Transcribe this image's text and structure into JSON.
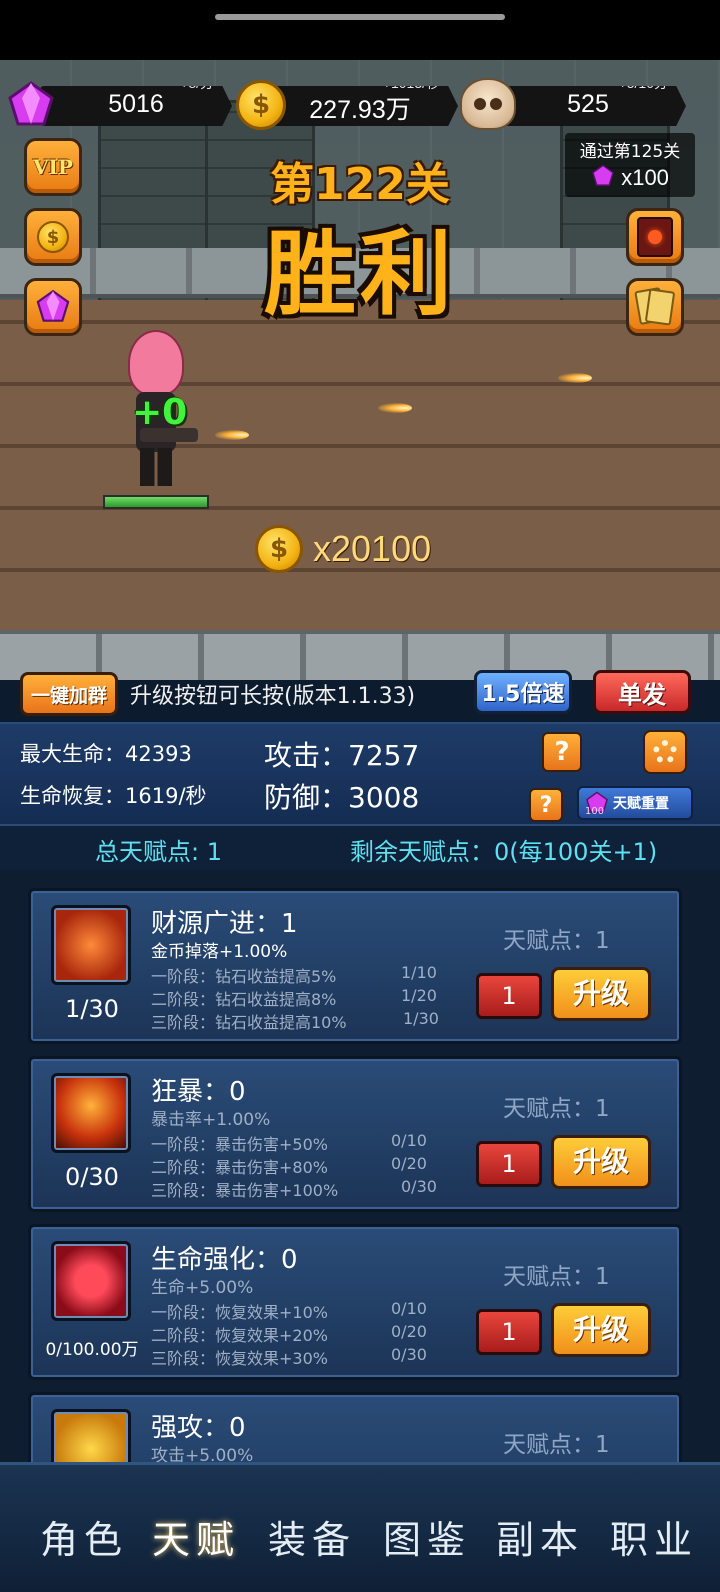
{
  "resources": {
    "gems": {
      "vip": "VIP:3",
      "value": "5016",
      "rate": "+8/分"
    },
    "gold": {
      "value": "227.93万",
      "rate": "+1013/秒"
    },
    "skulls": {
      "value": "525",
      "rate": "+5/10分"
    }
  },
  "side_buttons": {
    "vip": "VIP"
  },
  "stage_reward": {
    "title": "通过第125关",
    "amount": "x100"
  },
  "battle": {
    "level_title": "第122关",
    "result": "胜利",
    "heal_popup": "+0",
    "gold_drop": "x20100",
    "hp_fraction": 1.0
  },
  "actions": {
    "join_group": "一键加群",
    "tip": "升级按钮可长按(版本1.1.33)",
    "speed": "1.5倍速",
    "fire_mode": "单发"
  },
  "stats": {
    "max_hp": "最大生命：42393",
    "regen": "生命恢复：1619/秒",
    "attack": "攻击：7257",
    "defense": "防御：3008",
    "help": "?",
    "reset_cost": "100",
    "reset_label": "天赋重置"
  },
  "talent_summary": {
    "total": "总天赋点: 1",
    "remaining": "剩余天赋点：0(每100关+1)"
  },
  "talents": [
    {
      "name": "财源广进：1",
      "effect": "金币掉落+1.00%",
      "level": "1/30",
      "points": "天赋点：1",
      "count": "1",
      "upgrade": "升级",
      "stages": [
        {
          "text": "一阶段：钻石收益提高5%",
          "progress": "1/10"
        },
        {
          "text": "二阶段：钻石收益提高8%",
          "progress": "1/20"
        },
        {
          "text": "三阶段：钻石收益提高10%",
          "progress": "1/30"
        }
      ]
    },
    {
      "name": "狂暴：0",
      "effect": "暴击率+1.00%",
      "level": "0/30",
      "points": "天赋点：1",
      "count": "1",
      "upgrade": "升级",
      "stages": [
        {
          "text": "一阶段：暴击伤害+50%",
          "progress": "0/10"
        },
        {
          "text": "二阶段：暴击伤害+80%",
          "progress": "0/20"
        },
        {
          "text": "三阶段：暴击伤害+100%",
          "progress": "0/30"
        }
      ]
    },
    {
      "name": "生命强化：0",
      "effect": "生命+5.00%",
      "level": "0/100.00万",
      "points": "天赋点：1",
      "count": "1",
      "upgrade": "升级",
      "stages": [
        {
          "text": "一阶段：恢复效果+10%",
          "progress": "0/10"
        },
        {
          "text": "二阶段：恢复效果+20%",
          "progress": "0/20"
        },
        {
          "text": "三阶段：恢复效果+30%",
          "progress": "0/30"
        }
      ]
    },
    {
      "name": "强攻：0",
      "effect": "攻击+5.00%",
      "points": "天赋点：1"
    }
  ],
  "bottom_nav": [
    "角色",
    "天赋",
    "装备",
    "图鉴",
    "副本",
    "职业"
  ],
  "active_tab": "天赋",
  "colors": {
    "accent_orange": "#ffb21a",
    "cyan_text": "#5fe0f0",
    "panel_blue": "#1e3c68"
  }
}
